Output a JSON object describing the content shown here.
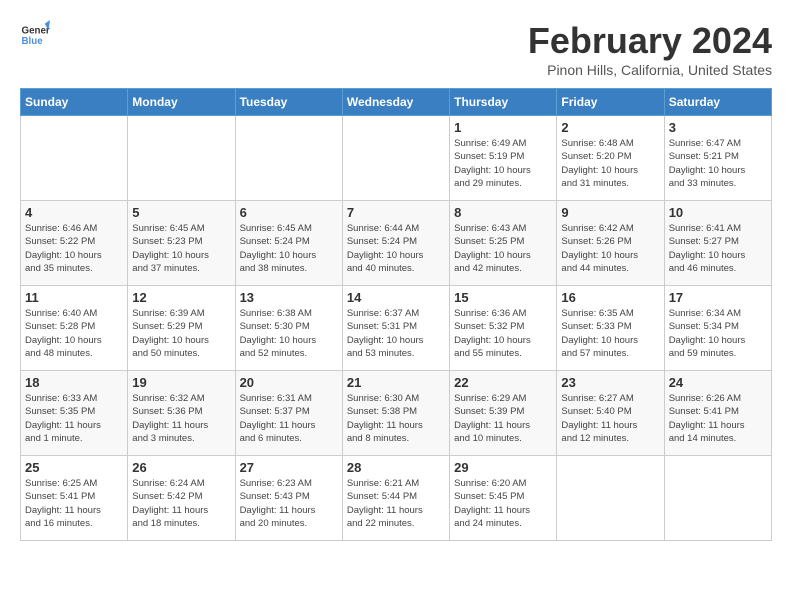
{
  "logo": {
    "line1": "General",
    "line2": "Blue"
  },
  "title": "February 2024",
  "location": "Pinon Hills, California, United States",
  "weekdays": [
    "Sunday",
    "Monday",
    "Tuesday",
    "Wednesday",
    "Thursday",
    "Friday",
    "Saturday"
  ],
  "weeks": [
    [
      {
        "day": "",
        "info": ""
      },
      {
        "day": "",
        "info": ""
      },
      {
        "day": "",
        "info": ""
      },
      {
        "day": "",
        "info": ""
      },
      {
        "day": "1",
        "info": "Sunrise: 6:49 AM\nSunset: 5:19 PM\nDaylight: 10 hours\nand 29 minutes."
      },
      {
        "day": "2",
        "info": "Sunrise: 6:48 AM\nSunset: 5:20 PM\nDaylight: 10 hours\nand 31 minutes."
      },
      {
        "day": "3",
        "info": "Sunrise: 6:47 AM\nSunset: 5:21 PM\nDaylight: 10 hours\nand 33 minutes."
      }
    ],
    [
      {
        "day": "4",
        "info": "Sunrise: 6:46 AM\nSunset: 5:22 PM\nDaylight: 10 hours\nand 35 minutes."
      },
      {
        "day": "5",
        "info": "Sunrise: 6:45 AM\nSunset: 5:23 PM\nDaylight: 10 hours\nand 37 minutes."
      },
      {
        "day": "6",
        "info": "Sunrise: 6:45 AM\nSunset: 5:24 PM\nDaylight: 10 hours\nand 38 minutes."
      },
      {
        "day": "7",
        "info": "Sunrise: 6:44 AM\nSunset: 5:24 PM\nDaylight: 10 hours\nand 40 minutes."
      },
      {
        "day": "8",
        "info": "Sunrise: 6:43 AM\nSunset: 5:25 PM\nDaylight: 10 hours\nand 42 minutes."
      },
      {
        "day": "9",
        "info": "Sunrise: 6:42 AM\nSunset: 5:26 PM\nDaylight: 10 hours\nand 44 minutes."
      },
      {
        "day": "10",
        "info": "Sunrise: 6:41 AM\nSunset: 5:27 PM\nDaylight: 10 hours\nand 46 minutes."
      }
    ],
    [
      {
        "day": "11",
        "info": "Sunrise: 6:40 AM\nSunset: 5:28 PM\nDaylight: 10 hours\nand 48 minutes."
      },
      {
        "day": "12",
        "info": "Sunrise: 6:39 AM\nSunset: 5:29 PM\nDaylight: 10 hours\nand 50 minutes."
      },
      {
        "day": "13",
        "info": "Sunrise: 6:38 AM\nSunset: 5:30 PM\nDaylight: 10 hours\nand 52 minutes."
      },
      {
        "day": "14",
        "info": "Sunrise: 6:37 AM\nSunset: 5:31 PM\nDaylight: 10 hours\nand 53 minutes."
      },
      {
        "day": "15",
        "info": "Sunrise: 6:36 AM\nSunset: 5:32 PM\nDaylight: 10 hours\nand 55 minutes."
      },
      {
        "day": "16",
        "info": "Sunrise: 6:35 AM\nSunset: 5:33 PM\nDaylight: 10 hours\nand 57 minutes."
      },
      {
        "day": "17",
        "info": "Sunrise: 6:34 AM\nSunset: 5:34 PM\nDaylight: 10 hours\nand 59 minutes."
      }
    ],
    [
      {
        "day": "18",
        "info": "Sunrise: 6:33 AM\nSunset: 5:35 PM\nDaylight: 11 hours\nand 1 minute."
      },
      {
        "day": "19",
        "info": "Sunrise: 6:32 AM\nSunset: 5:36 PM\nDaylight: 11 hours\nand 3 minutes."
      },
      {
        "day": "20",
        "info": "Sunrise: 6:31 AM\nSunset: 5:37 PM\nDaylight: 11 hours\nand 6 minutes."
      },
      {
        "day": "21",
        "info": "Sunrise: 6:30 AM\nSunset: 5:38 PM\nDaylight: 11 hours\nand 8 minutes."
      },
      {
        "day": "22",
        "info": "Sunrise: 6:29 AM\nSunset: 5:39 PM\nDaylight: 11 hours\nand 10 minutes."
      },
      {
        "day": "23",
        "info": "Sunrise: 6:27 AM\nSunset: 5:40 PM\nDaylight: 11 hours\nand 12 minutes."
      },
      {
        "day": "24",
        "info": "Sunrise: 6:26 AM\nSunset: 5:41 PM\nDaylight: 11 hours\nand 14 minutes."
      }
    ],
    [
      {
        "day": "25",
        "info": "Sunrise: 6:25 AM\nSunset: 5:41 PM\nDaylight: 11 hours\nand 16 minutes."
      },
      {
        "day": "26",
        "info": "Sunrise: 6:24 AM\nSunset: 5:42 PM\nDaylight: 11 hours\nand 18 minutes."
      },
      {
        "day": "27",
        "info": "Sunrise: 6:23 AM\nSunset: 5:43 PM\nDaylight: 11 hours\nand 20 minutes."
      },
      {
        "day": "28",
        "info": "Sunrise: 6:21 AM\nSunset: 5:44 PM\nDaylight: 11 hours\nand 22 minutes."
      },
      {
        "day": "29",
        "info": "Sunrise: 6:20 AM\nSunset: 5:45 PM\nDaylight: 11 hours\nand 24 minutes."
      },
      {
        "day": "",
        "info": ""
      },
      {
        "day": "",
        "info": ""
      }
    ]
  ]
}
